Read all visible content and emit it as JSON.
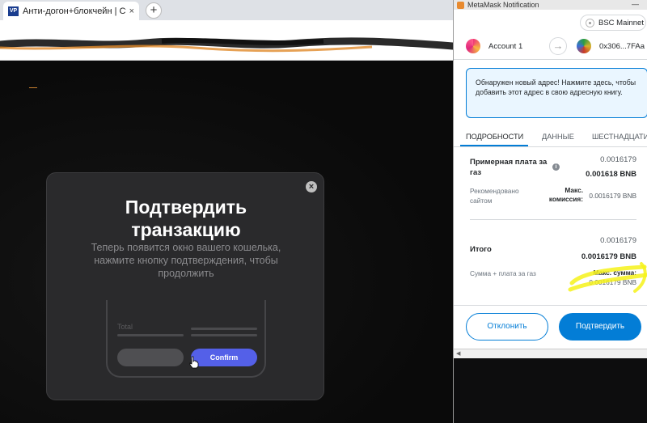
{
  "browser": {
    "tab_favicon_text": "VP",
    "tab_title": "Анти-догон+блокчейн | Страни",
    "tab_close": "×",
    "new_tab": "+"
  },
  "modal": {
    "close": "×",
    "title_line1": "Подтвердить",
    "title_line2": "транзакцию",
    "description": "Теперь появится окно вашего кошелька, нажмите кнопку подтверждения, чтобы продолжить",
    "phone_total_label": "Total",
    "phone_confirm_label": "Confirm"
  },
  "metamask": {
    "window_title": "MetaMask Notification",
    "minimize": "—",
    "network": "BSC Mainnet",
    "from_account": "Account 1",
    "to_address": "0x306...7FAa",
    "alert": "Обнаружен новый адрес! Нажмите здесь, чтобы добавить этот адрес в свою адресную книгу.",
    "tabs": [
      "ПОДРОБНОСТИ",
      "ДАННЫЕ",
      "ШЕСТНАДЦАТИ"
    ],
    "gas": {
      "label": "Примерная плата за газ",
      "value_top": "0.0016179",
      "value_main": "0.001618 BNB",
      "recommended_label": "Рекомендовано сайтом",
      "max_fee_label": "Макс. комиссия:",
      "max_fee_value": "0.0016179 BNB"
    },
    "total": {
      "label": "Итого",
      "value_top": "0.0016179",
      "value_main": "0.0016179 BNB",
      "sum_label": "Сумма + плата за газ",
      "max_sum_label": "Макс. сумма:",
      "max_sum_value": "0.0016179 BNB"
    },
    "buttons": {
      "reject": "Отклонить",
      "confirm": "Подтвердить"
    },
    "accent_color": "#037dd6"
  }
}
